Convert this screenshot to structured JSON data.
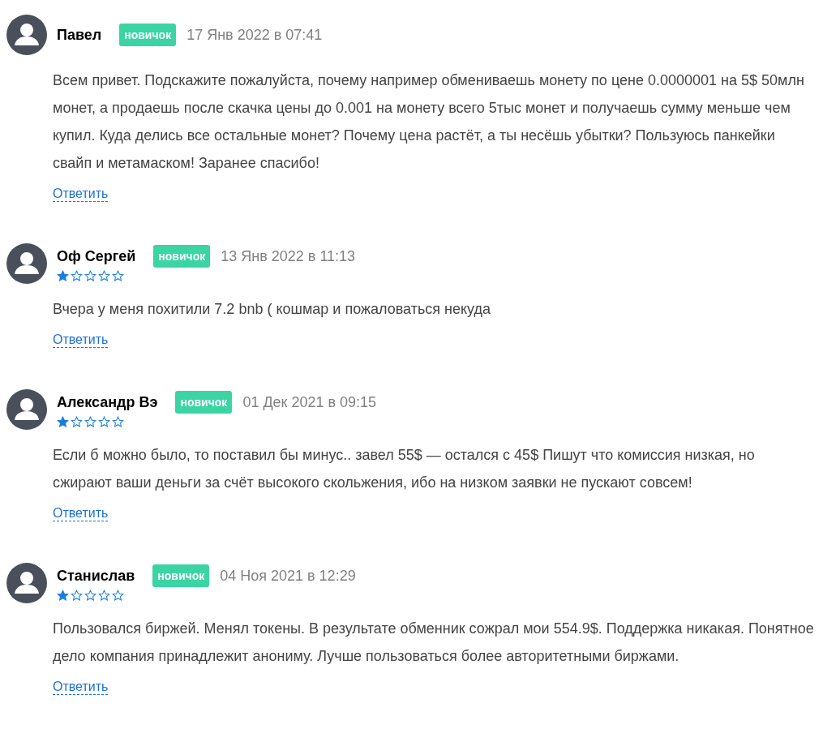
{
  "comments": [
    {
      "author": "Павел",
      "badge": "новичок",
      "date": "17 Янв 2022 в 07:41",
      "text": "Всем привет. Подскажите пожалуйста, почему например обмениваешь монету по цене 0.0000001 на 5$ 50млн монет, а продаешь после скачка цены до 0.001 на монету всего 5тыс монет и получаешь сумму меньше чем купил. Куда делись все остальные монет? Почему цена растёт, а ты несёшь убытки? Пользуюсь панкейки свайп и метамаском! Заранее спасибо!",
      "reply": "Ответить"
    },
    {
      "author": "Оф Сергей",
      "badge": "новичок",
      "date": "13 Янв 2022 в 11:13",
      "stars": 1,
      "text": "Вчера у меня похитили 7.2 bnb ( кошмар и пожаловаться некуда",
      "reply": "Ответить"
    },
    {
      "author": "Александр Вэ",
      "badge": "новичок",
      "date": "01 Дек 2021 в 09:15",
      "stars": 1,
      "text": "Если б можно было, то поставил бы минус.. завел 55$ — остался с 45$ Пишут что комиссия низкая, но сжирают ваши деньги за счёт высокого скольжения, ибо на низком заявки не пускают совсем!",
      "reply": "Ответить"
    },
    {
      "author": "Станислав",
      "badge": "новичок",
      "date": "04 Ноя 2021 в 12:29",
      "stars": 1,
      "text": "Пользовался биржей. Менял токены. В результате обменник сожрал мои 554.9$. Поддержка никакая. Понятное дело компания принадлежит анониму. Лучше пользоваться более авторитетными биржами.",
      "reply": "Ответить"
    }
  ]
}
